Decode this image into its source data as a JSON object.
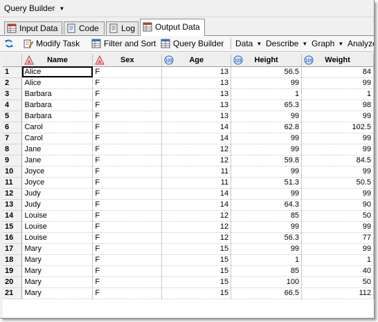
{
  "window": {
    "title": "Query Builder"
  },
  "tabs": [
    {
      "label": "Input Data",
      "icon": "table-icon"
    },
    {
      "label": "Code",
      "icon": "code-icon"
    },
    {
      "label": "Log",
      "icon": "log-icon"
    },
    {
      "label": "Output Data",
      "icon": "table-icon",
      "active": true
    }
  ],
  "toolbar": {
    "refresh_icon": "refresh-icon",
    "modify_task": "Modify Task",
    "filter_sort": "Filter and Sort",
    "query_builder": "Query Builder",
    "data": "Data",
    "describe": "Describe",
    "graph": "Graph",
    "analyze": "Analyze"
  },
  "grid": {
    "columns": [
      {
        "name": "Name",
        "type": "character",
        "icon": "character-column-icon"
      },
      {
        "name": "Sex",
        "type": "character",
        "icon": "character-column-icon"
      },
      {
        "name": "Age",
        "type": "numeric",
        "icon": "numeric-column-icon"
      },
      {
        "name": "Height",
        "type": "numeric",
        "icon": "numeric-column-icon"
      },
      {
        "name": "Weight",
        "type": "numeric",
        "icon": "numeric-column-icon"
      }
    ],
    "rows": [
      [
        "1",
        "Alice",
        "F",
        "13",
        "56.5",
        "84"
      ],
      [
        "2",
        "Alice",
        "F",
        "13",
        "99",
        "99"
      ],
      [
        "3",
        "Barbara",
        "F",
        "13",
        "1",
        "1"
      ],
      [
        "4",
        "Barbara",
        "F",
        "13",
        "65.3",
        "98"
      ],
      [
        "5",
        "Barbara",
        "F",
        "13",
        "99",
        "99"
      ],
      [
        "6",
        "Carol",
        "F",
        "14",
        "62.8",
        "102.5"
      ],
      [
        "7",
        "Carol",
        "F",
        "14",
        "99",
        "99"
      ],
      [
        "8",
        "Jane",
        "F",
        "12",
        "99",
        "99"
      ],
      [
        "9",
        "Jane",
        "F",
        "12",
        "59.8",
        "84.5"
      ],
      [
        "10",
        "Joyce",
        "F",
        "11",
        "99",
        "99"
      ],
      [
        "11",
        "Joyce",
        "F",
        "11",
        "51.3",
        "50.5"
      ],
      [
        "12",
        "Judy",
        "F",
        "14",
        "99",
        "99"
      ],
      [
        "13",
        "Judy",
        "F",
        "14",
        "64.3",
        "90"
      ],
      [
        "14",
        "Louise",
        "F",
        "12",
        "85",
        "50"
      ],
      [
        "15",
        "Louise",
        "F",
        "12",
        "99",
        "99"
      ],
      [
        "16",
        "Louise",
        "F",
        "12",
        "56.3",
        "77"
      ],
      [
        "17",
        "Mary",
        "F",
        "15",
        "99",
        "99"
      ],
      [
        "18",
        "Mary",
        "F",
        "15",
        "1",
        "1"
      ],
      [
        "19",
        "Mary",
        "F",
        "15",
        "85",
        "40"
      ],
      [
        "20",
        "Mary",
        "F",
        "15",
        "100",
        "50"
      ],
      [
        "21",
        "Mary",
        "F",
        "15",
        "66.5",
        "112"
      ]
    ]
  }
}
